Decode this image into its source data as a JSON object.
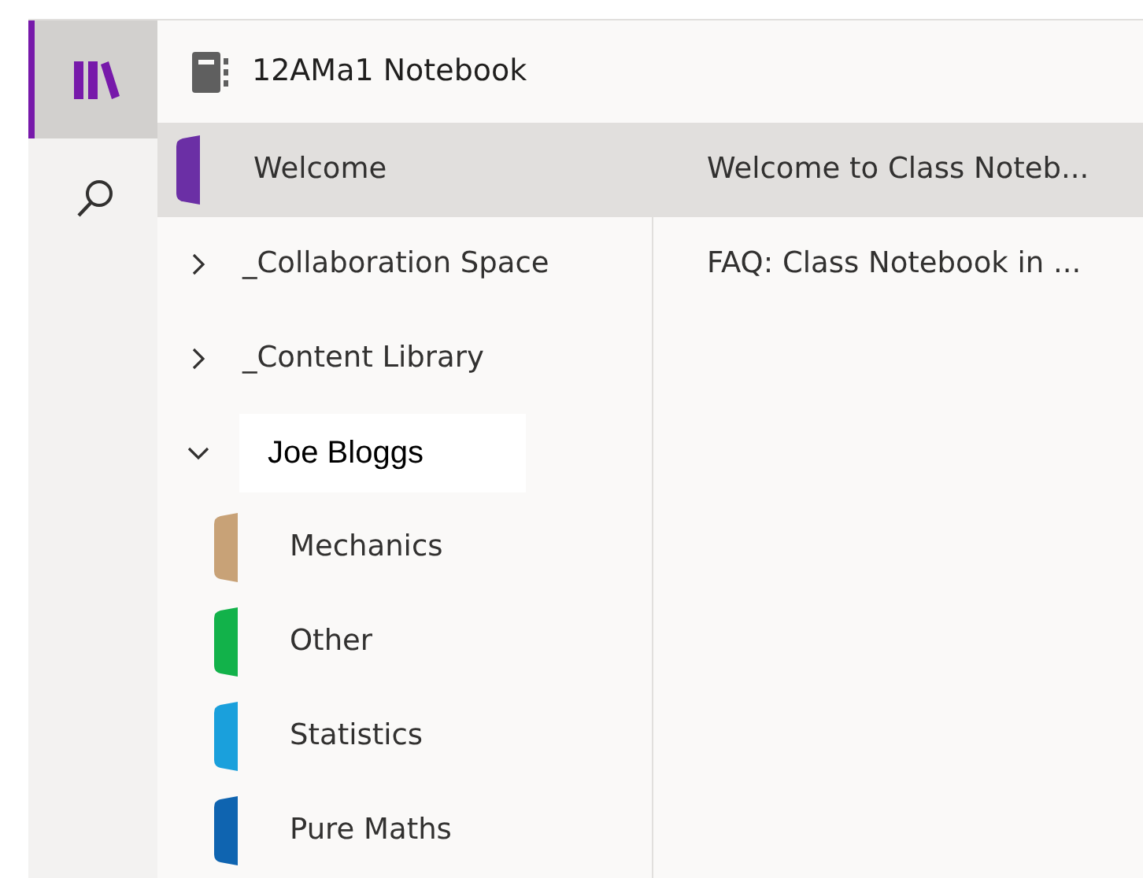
{
  "rail": [
    {
      "kind": "library",
      "selected": true
    },
    {
      "kind": "search",
      "selected": false
    }
  ],
  "notebook": {
    "title": "12AMa1 Notebook"
  },
  "sections": [
    {
      "kind": "section",
      "label": "Welcome",
      "color": "#6b2fa5",
      "selected": true
    },
    {
      "kind": "group",
      "label": "_Collaboration Space",
      "expanded": false,
      "selected": false
    },
    {
      "kind": "group",
      "label": "_Content Library",
      "expanded": false,
      "selected": false
    },
    {
      "kind": "group",
      "label": "Joe Bloggs",
      "expanded": true,
      "selected": false,
      "editing": true,
      "children": [
        {
          "kind": "section",
          "label": "Mechanics",
          "color": "#c8a277",
          "selected": false
        },
        {
          "kind": "section",
          "label": "Other",
          "color": "#12b24a",
          "selected": false
        },
        {
          "kind": "section",
          "label": "Statistics",
          "color": "#1aa0dc",
          "selected": false
        },
        {
          "kind": "section",
          "label": "Pure Maths",
          "color": "#0f64b0",
          "selected": false
        }
      ]
    }
  ],
  "pages": [
    {
      "label": "Welcome to Class Noteb...",
      "selected": true
    },
    {
      "label": "FAQ: Class Notebook in ...",
      "selected": false
    }
  ]
}
